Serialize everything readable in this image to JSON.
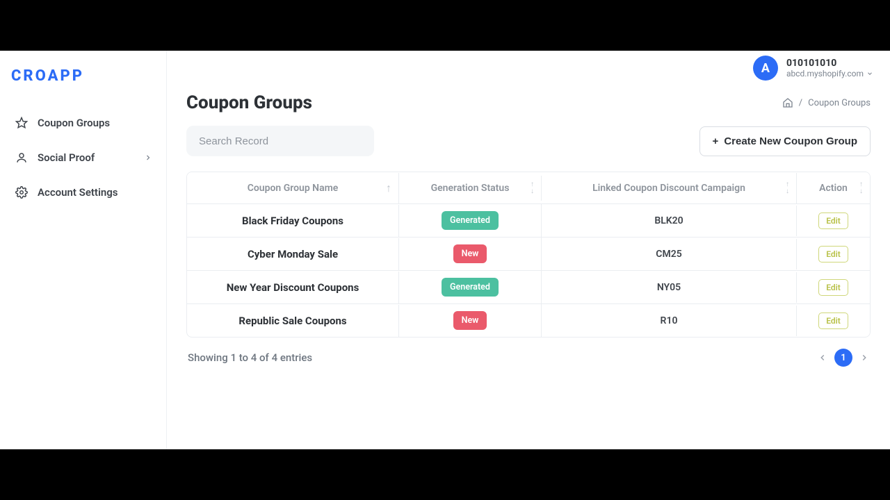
{
  "brand": "CROAPP",
  "sidebar": {
    "items": [
      {
        "label": "Coupon Groups"
      },
      {
        "label": "Social Proof"
      },
      {
        "label": "Account Settings"
      }
    ]
  },
  "header": {
    "avatar_letter": "A",
    "account_name": "010101010",
    "account_domain": "abcd.myshopify.com"
  },
  "page": {
    "title": "Coupon Groups",
    "breadcrumb_sep": "/",
    "breadcrumb_current": "Coupon Groups"
  },
  "search": {
    "placeholder": "Search Record",
    "value": ""
  },
  "buttons": {
    "create": "Create New Coupon Group",
    "edit": "Edit"
  },
  "table": {
    "columns": {
      "name": "Coupon Group Name",
      "status": "Generation Status",
      "linked": "Linked Coupon Discount Campaign",
      "action": "Action"
    },
    "rows": [
      {
        "name": "Black Friday Coupons",
        "status": "Generated",
        "status_kind": "green",
        "linked": "BLK20"
      },
      {
        "name": "Cyber Monday Sale",
        "status": "New",
        "status_kind": "red",
        "linked": "CM25"
      },
      {
        "name": "New Year Discount Coupons",
        "status": "Generated",
        "status_kind": "green",
        "linked": "NY05"
      },
      {
        "name": "Republic Sale Coupons",
        "status": "New",
        "status_kind": "red",
        "linked": "R10"
      }
    ]
  },
  "footer": {
    "entries": "Showing 1 to 4 of 4 entries",
    "page": "1"
  }
}
